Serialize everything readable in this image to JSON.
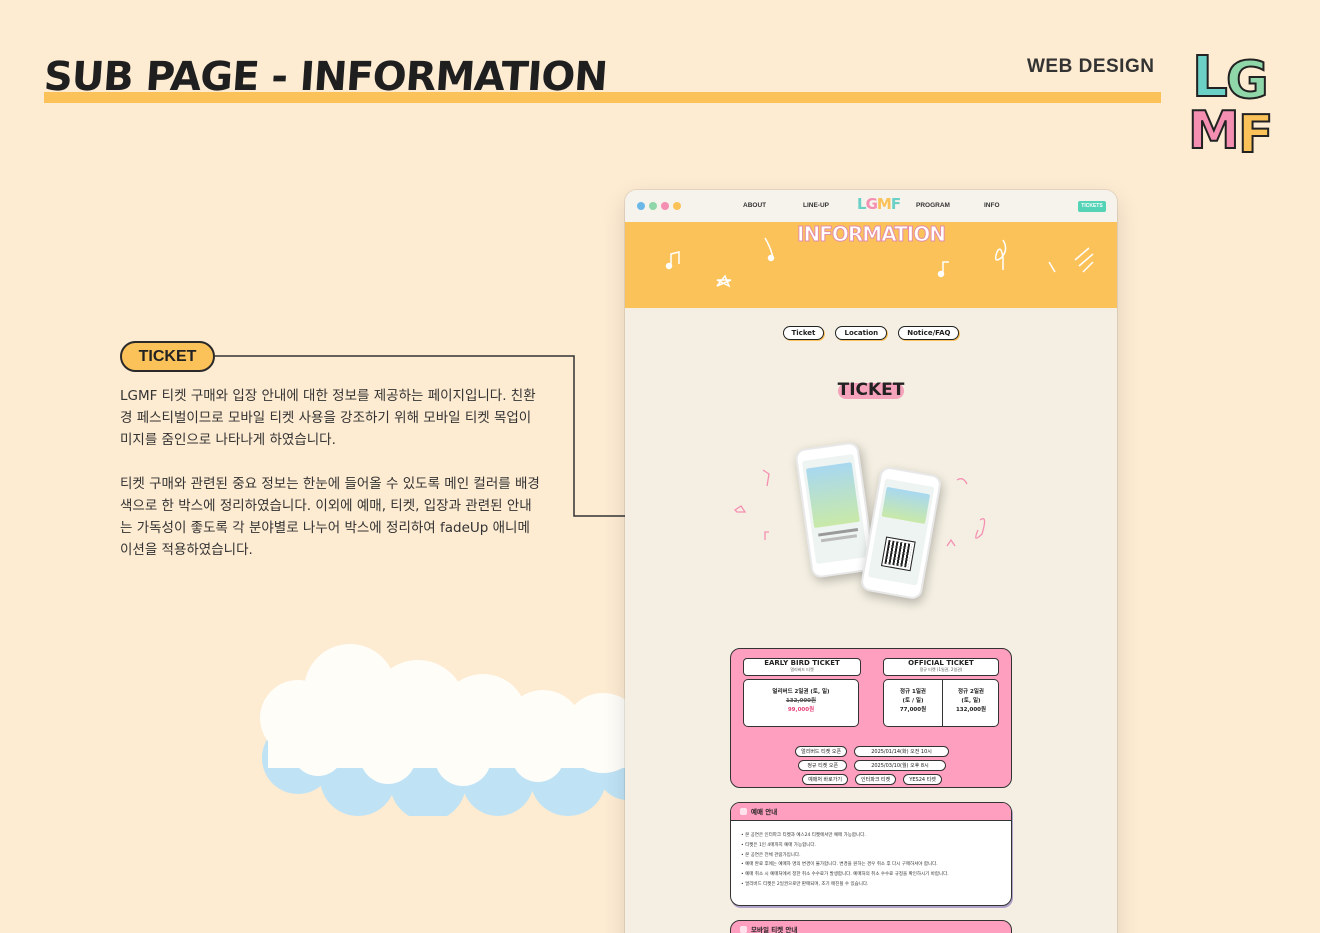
{
  "header": {
    "title": "SUB PAGE - INFORMATION",
    "web_design": "WEB DESIGN"
  },
  "annotation": {
    "pill": "TICKET",
    "paragraphs": [
      "LGMF 티켓 구매와 입장 안내에 대한 정보를 제공하는 페이지입니다. 친환경 페스티벌이므로 모바일 티켓 사용을 강조하기 위해 모바일 티켓 목업이미지를 줌인으로 나타나게 하였습니다.",
      "티켓 구매와 관련된 중요 정보는 한눈에 들어올 수 있도록 메인 컬러를 배경색으로 한 박스에 정리하였습니다. 이외에 예매, 티켓, 입장과 관련된 안내는 가독성이 좋도록 각 분야별로 나누어 박스에 정리하여 fadeUp 애니메이션을 적용하였습니다."
    ]
  },
  "mockup": {
    "nav": {
      "links": [
        "ABOUT",
        "LINE-UP",
        "PROGRAM",
        "INFO"
      ],
      "logo": [
        "L",
        "G",
        "M",
        "F"
      ],
      "tickets_button": "TICKETS"
    },
    "hero_title": "INFORMATION",
    "subtabs": [
      "Ticket",
      "Location",
      "Notice/FAQ"
    ],
    "section_title": "TICKET",
    "early_bird": {
      "title": "EARLY BIRD TICKET",
      "subtitle": "얼리버드 티켓",
      "line1": "얼리버드 2일권 (토, 일)",
      "old_price": "132,000원",
      "price": "99,000원"
    },
    "official": {
      "title": "OFFICIAL TICKET",
      "subtitle": "정규 티켓 (1일권, 2일권)",
      "day1_name": "정규 1일권",
      "day1_days": "(토 / 일)",
      "day1_price": "77,000원",
      "day2_name": "정규 2일권",
      "day2_days": "(토, 일)",
      "day2_price": "132,000원"
    },
    "schedule": {
      "row1_label": "얼리버드 티켓 오픈",
      "row1_value": "2025/01/14(화) 오전 10시",
      "row2_label": "정규 티켓 오픈",
      "row2_value": "2025/03/10(월) 오후 8시",
      "row3_label": "예매처 바로가기",
      "row3_link1": "인터파크 티켓",
      "row3_link2": "YES24 티켓"
    },
    "notice_title": "예매 안내",
    "notice_items": [
      "본 공연은 인터파크 티켓과 예스24 티켓에서만 예매 가능합니다.",
      "티켓은 1인 4매까지 예매 가능합니다.",
      "본 공연은 전체 관람가입니다.",
      "예매 완료 후에는 예매자 명의 변경이 불가합니다. 변경을 원하는 경우 취소 후 다시 구매하셔야 합니다.",
      "예매 취소 시 예매처에서 정한 취소 수수료가 발생합니다. 예매처의 취소 수수료 규정을 확인하시기 바랍니다.",
      "얼리버드 티켓은 2일권으로만 판매되며, 조기 매진될 수 있습니다."
    ],
    "mobile_notice_title": "모바일 티켓 안내"
  },
  "colors": {
    "background": "#fdebd2",
    "accent_yellow": "#fbc25a",
    "accent_pink": "#ff9fc0",
    "accent_mint": "#55d3b7",
    "mock_bg": "#f4efe2"
  }
}
